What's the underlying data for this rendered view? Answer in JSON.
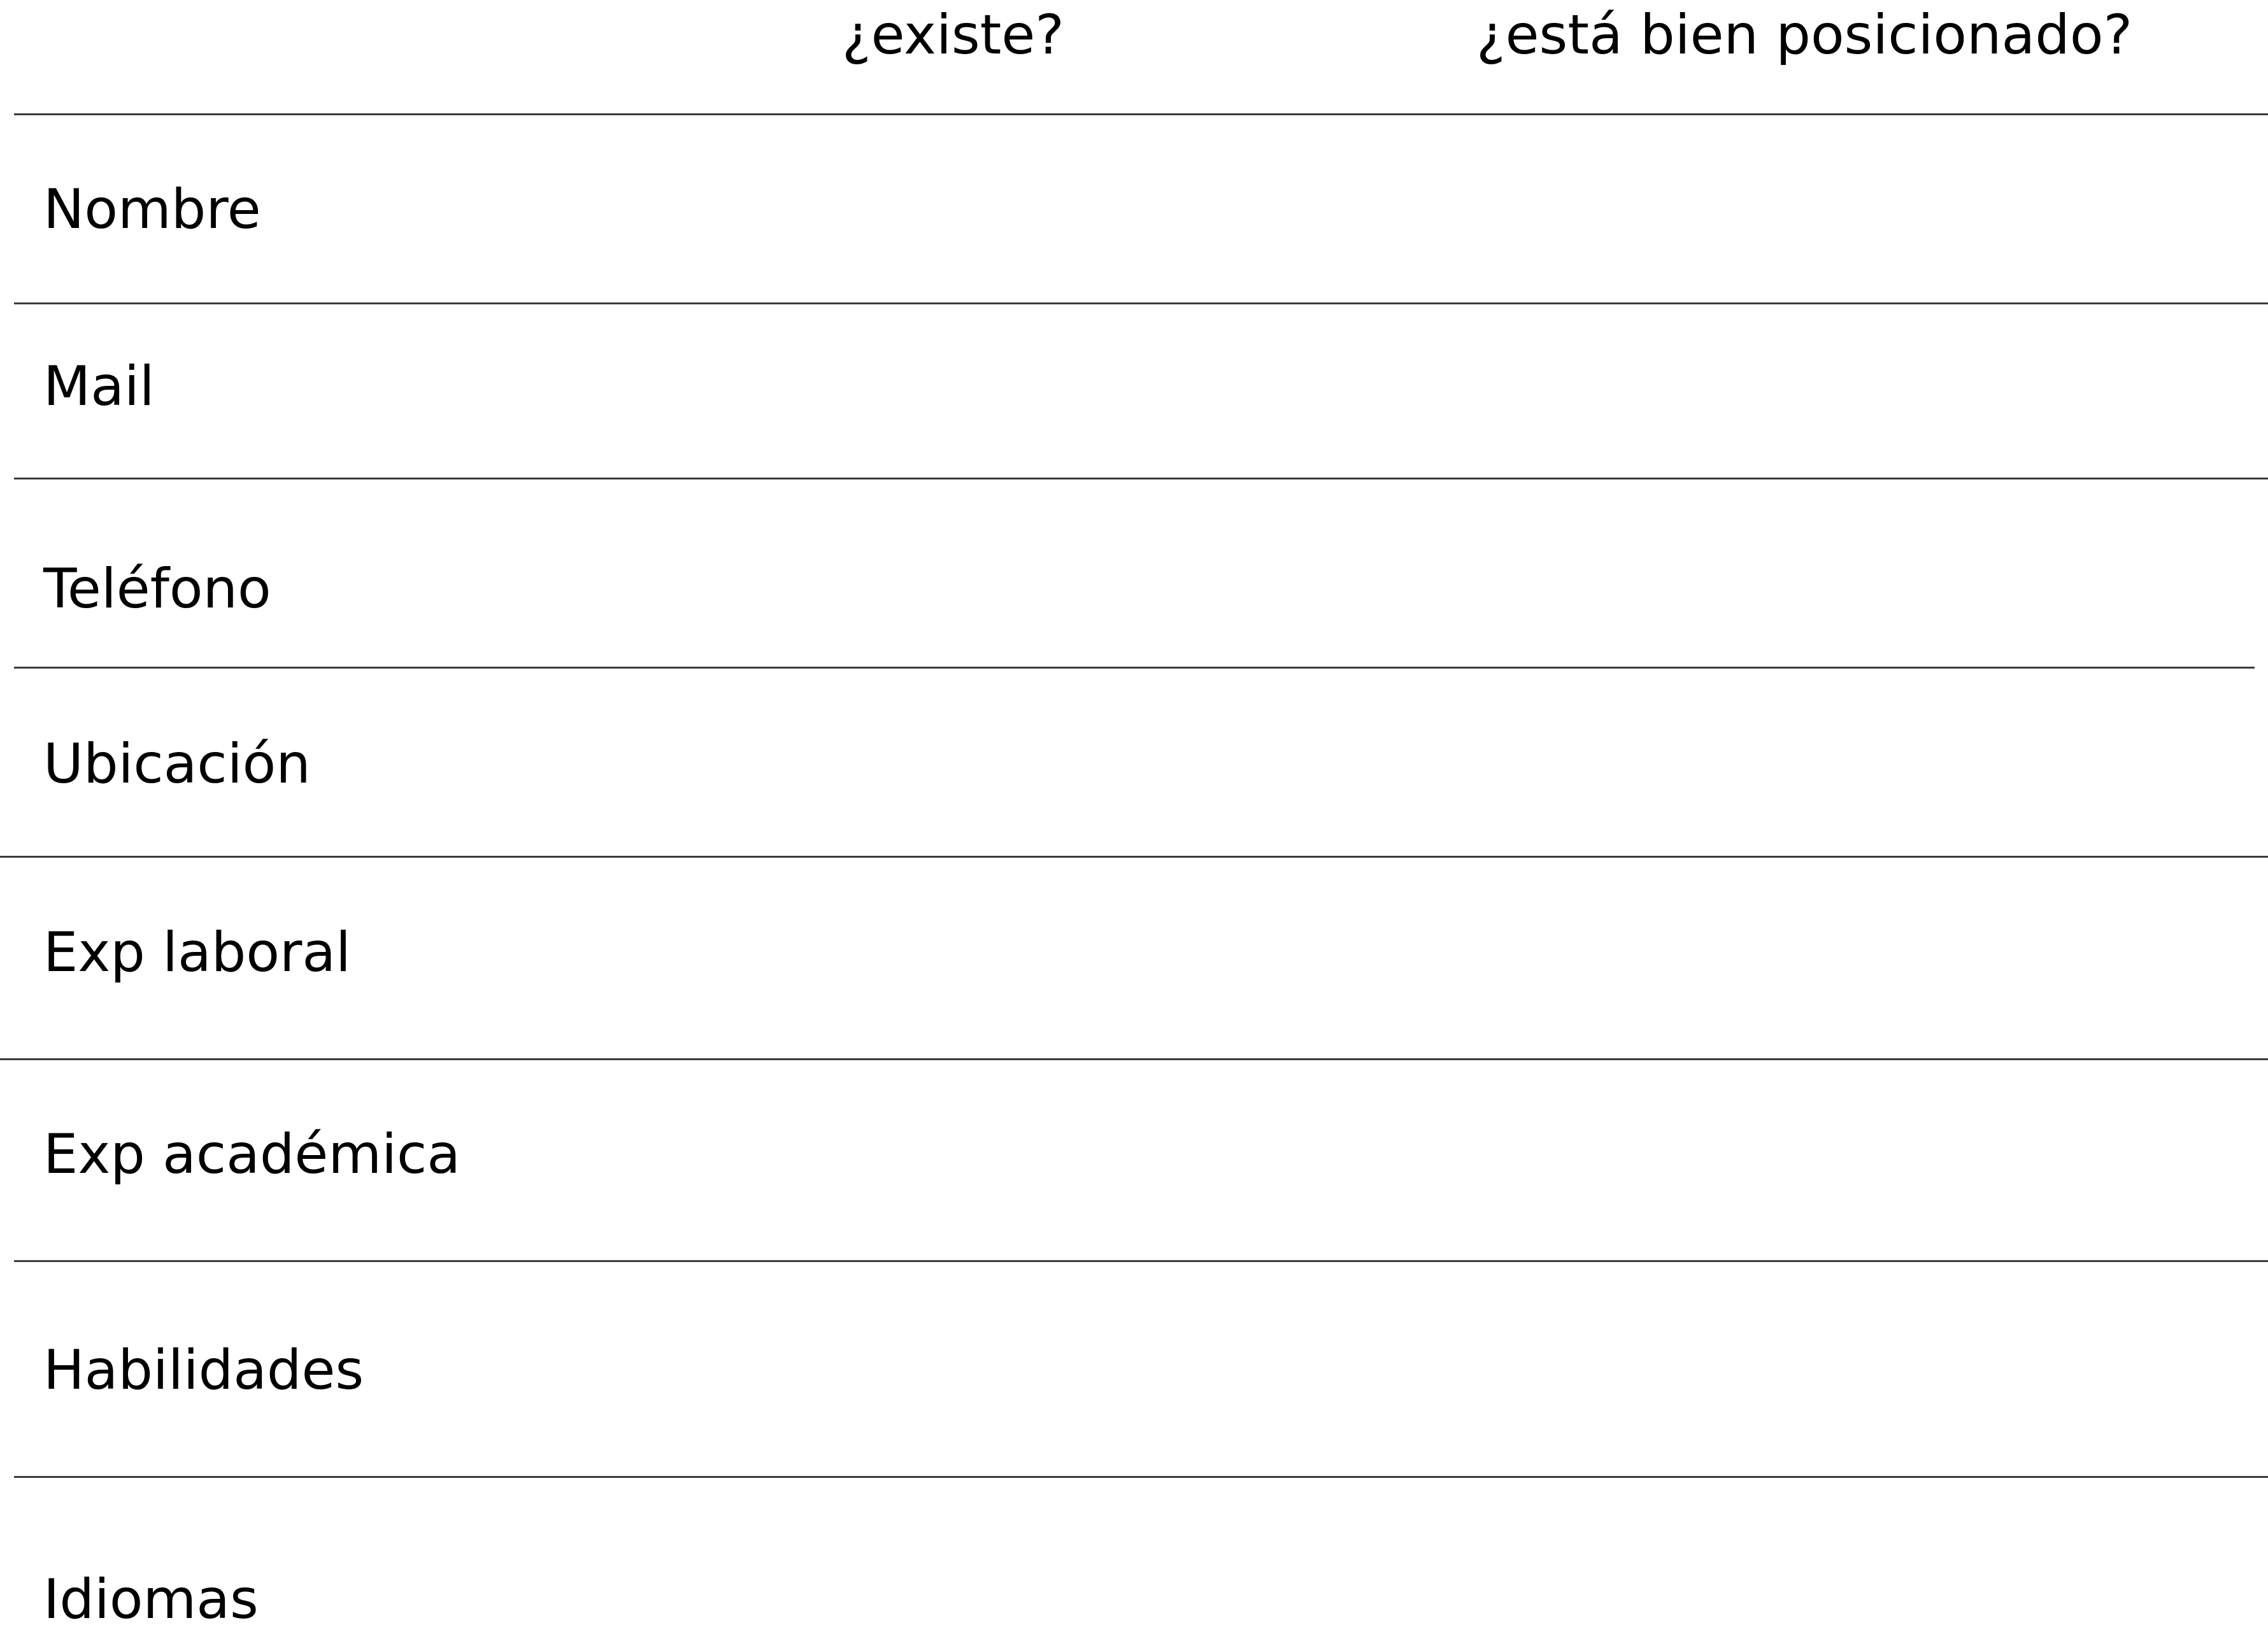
{
  "table": {
    "columns": [
      "",
      "¿existe?",
      "¿está bien posicionado?"
    ],
    "rows": [
      {
        "label": "Nombre",
        "exists": "",
        "well_positioned": ""
      },
      {
        "label": "Mail",
        "exists": "",
        "well_positioned": ""
      },
      {
        "label": "Teléfono",
        "exists": "",
        "well_positioned": ""
      },
      {
        "label": "Ubicación",
        "exists": "",
        "well_positioned": ""
      },
      {
        "label": "Exp laboral",
        "exists": "",
        "well_positioned": ""
      },
      {
        "label": "Exp académica",
        "exists": "",
        "well_positioned": ""
      },
      {
        "label": "Habilidades",
        "exists": "",
        "well_positioned": ""
      },
      {
        "label": "Idiomas",
        "exists": "",
        "well_positioned": ""
      }
    ]
  }
}
